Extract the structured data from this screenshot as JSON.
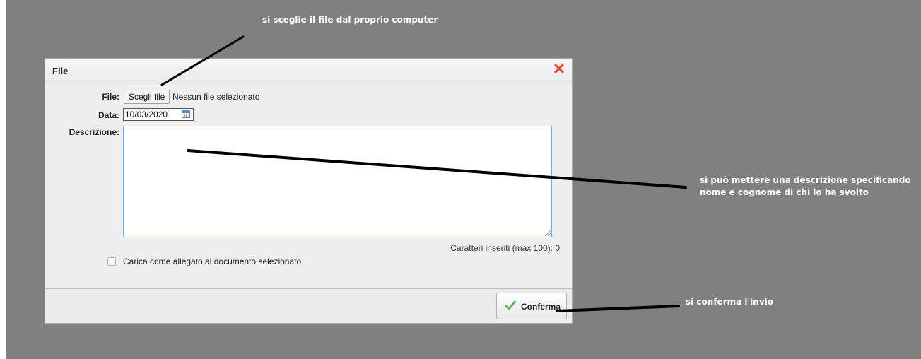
{
  "annotations": {
    "top": "si sceglie il file dal proprio computer",
    "description": "si può mettere una descrizione specificando nome e cognome di chi lo ha svolto",
    "confirm": "si conferma l'invio"
  },
  "dialog": {
    "title": "File",
    "close_icon": "close-icon",
    "file_label": "File:",
    "file_button": "Scegli file",
    "file_status": "Nessun file selezionato",
    "date_label": "Data:",
    "date_value": "10/03/2020",
    "description_label": "Descrizione:",
    "description_value": "",
    "counter": "Caratteri inseriti (max 100): 0",
    "checkbox_label": "Carica come allegato al documento selezionato",
    "checkbox_checked": false,
    "confirm_label": "Conferma"
  },
  "colors": {
    "backdrop": "#808080",
    "close": "#e0452c",
    "confirm_check": "#5cb85c",
    "annotation_text": "#ffffff"
  }
}
